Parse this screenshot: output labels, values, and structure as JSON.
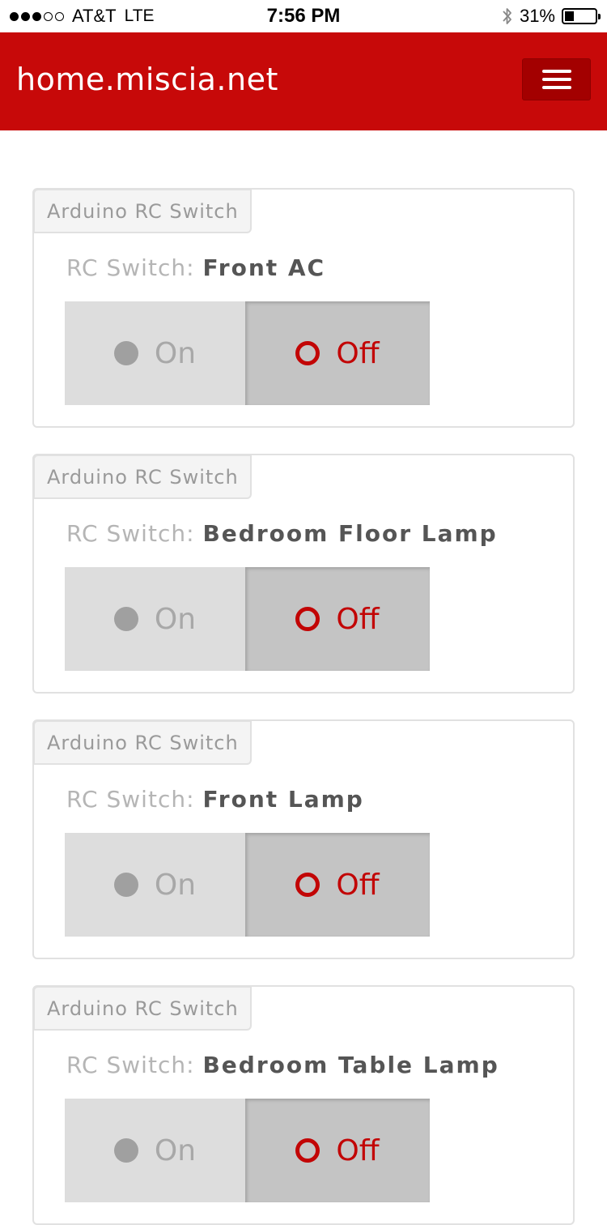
{
  "status_bar": {
    "carrier": "AT&T",
    "network": "LTE",
    "time": "7:56 PM",
    "battery": "31%",
    "battery_level": 0.31,
    "signal_bars": 3,
    "signal_total": 5
  },
  "navbar": {
    "brand": "home.miscia.net",
    "menu_icon": "hamburger-menu-icon"
  },
  "colors": {
    "brand_red": "#c70909",
    "off_red": "#c20505"
  },
  "cards": [
    {
      "tab_label": "Arduino RC Switch",
      "title_label": "RC Switch:",
      "device_name": "Front AC",
      "on_label": "On",
      "off_label": "Off",
      "state": "off"
    },
    {
      "tab_label": "Arduino RC Switch",
      "title_label": "RC Switch:",
      "device_name": "Bedroom Floor Lamp",
      "on_label": "On",
      "off_label": "Off",
      "state": "off"
    },
    {
      "tab_label": "Arduino RC Switch",
      "title_label": "RC Switch:",
      "device_name": "Front Lamp",
      "on_label": "On",
      "off_label": "Off",
      "state": "off"
    },
    {
      "tab_label": "Arduino RC Switch",
      "title_label": "RC Switch:",
      "device_name": "Bedroom Table Lamp",
      "on_label": "On",
      "off_label": "Off",
      "state": "off"
    }
  ]
}
